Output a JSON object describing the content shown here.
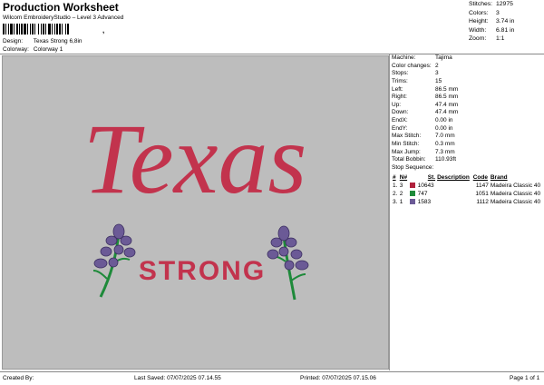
{
  "header": {
    "title": "Production Worksheet",
    "subtitle": "Wilcom EmbroideryStudio – Level 3 Advanced",
    "barcode_mark": ",",
    "design_label": "Design:",
    "design_value": "Texas Strong 6,8in",
    "colorway_label": "Colorway:",
    "colorway_value": "Colorway 1"
  },
  "stats": [
    {
      "label": "Stitches:",
      "value": "12975"
    },
    {
      "label": "Colors:",
      "value": "3"
    },
    {
      "label": "Height:",
      "value": "3.74 in"
    },
    {
      "label": "Width:",
      "value": "6.81 in"
    },
    {
      "label": "Zoom:",
      "value": "1:1"
    }
  ],
  "machine_info": [
    {
      "label": "Machine:",
      "value": "Tajima"
    },
    {
      "label": "Color changes:",
      "value": "2"
    },
    {
      "label": "Stops:",
      "value": "3"
    },
    {
      "label": "Trims:",
      "value": "15"
    },
    {
      "label": "Left:",
      "value": "86.5 mm"
    },
    {
      "label": "Right:",
      "value": "86.5 mm"
    },
    {
      "label": "Up:",
      "value": "47.4 mm"
    },
    {
      "label": "Down:",
      "value": "47.4 mm"
    },
    {
      "label": "EndX:",
      "value": "0.00 in"
    },
    {
      "label": "EndY:",
      "value": "0.00 in"
    },
    {
      "label": "Max Stitch:",
      "value": "7.0 mm"
    },
    {
      "label": "Min Stitch:",
      "value": "0.3 mm"
    },
    {
      "label": "Max Jump:",
      "value": "7.3 mm"
    },
    {
      "label": "Total Bobbin:",
      "value": "110.93ft"
    },
    {
      "label": "Stop Sequence:",
      "value": ""
    }
  ],
  "sequence": {
    "headers": [
      "#",
      "N#",
      "St.",
      "Description",
      "Code",
      "Brand"
    ],
    "rows": [
      {
        "num": "1.",
        "n": "3",
        "color": "#b0213c",
        "st": "10643",
        "desc": "",
        "code": "1147",
        "brand": "Madeira Classic 40"
      },
      {
        "num": "2.",
        "n": "2",
        "color": "#1e8a3a",
        "st": "747",
        "desc": "",
        "code": "1051",
        "brand": "Madeira Classic 40"
      },
      {
        "num": "3.",
        "n": "1",
        "color": "#6b5a96",
        "st": "1583",
        "desc": "",
        "code": "1112",
        "brand": "Madeira Classic 40"
      }
    ]
  },
  "design": {
    "word1": "Texas",
    "word2": "STRONG",
    "background": "#bdbdbd",
    "text_color": "#c2334d",
    "stem_color": "#1e8a3a",
    "flower_color": "#6b5a96"
  },
  "footer": {
    "created_by": "Created By:",
    "last_saved": "Last Saved: 07/07/2025 07.14.55",
    "printed": "Printed: 07/07/2025 07.15.06",
    "page": "Page 1 of 1"
  }
}
